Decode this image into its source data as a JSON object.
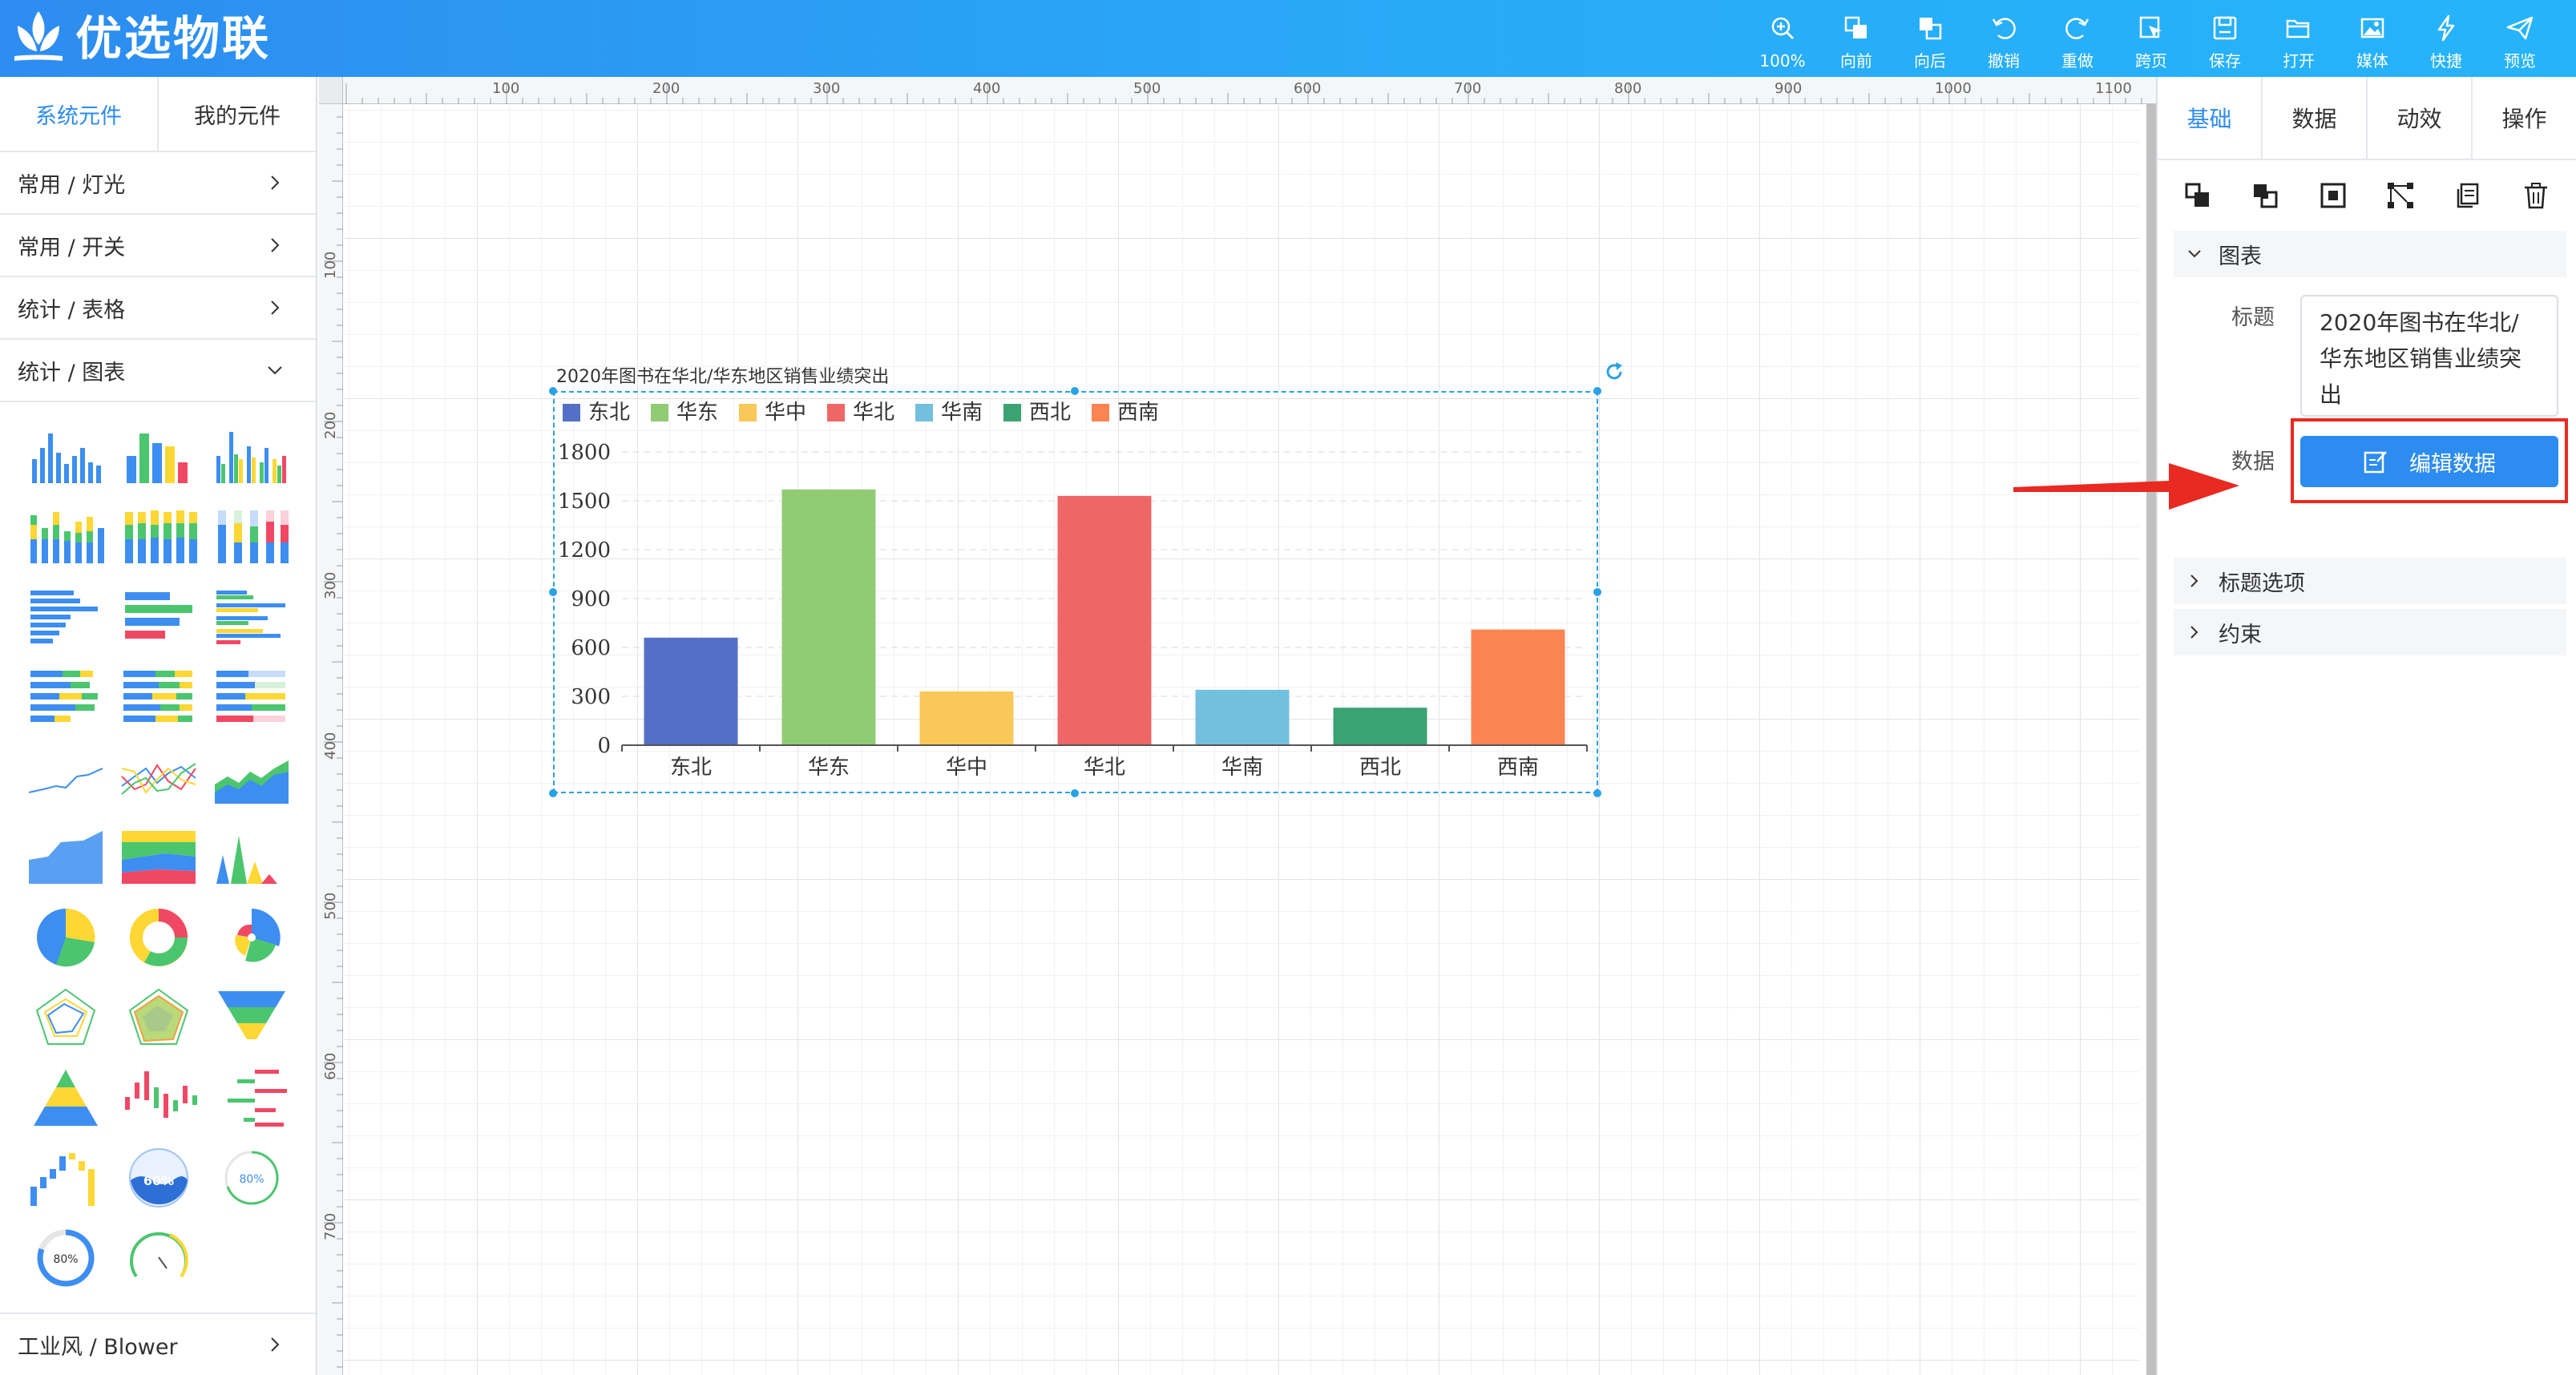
{
  "app": {
    "name": "优选物联"
  },
  "toolbar": [
    {
      "label": "100%",
      "icon": "zoom-in-icon"
    },
    {
      "label": "向前",
      "icon": "bring-forward-icon"
    },
    {
      "label": "向后",
      "icon": "send-backward-icon"
    },
    {
      "label": "撤销",
      "icon": "undo-icon"
    },
    {
      "label": "重做",
      "icon": "redo-icon"
    },
    {
      "label": "跨页",
      "icon": "cross-page-icon"
    },
    {
      "label": "保存",
      "icon": "save-icon"
    },
    {
      "label": "打开",
      "icon": "folder-open-icon"
    },
    {
      "label": "媒体",
      "icon": "media-icon"
    },
    {
      "label": "快捷",
      "icon": "lightning-icon"
    },
    {
      "label": "预览",
      "icon": "paper-plane-icon"
    }
  ],
  "left_panel": {
    "tabs": [
      {
        "label": "系统元件",
        "active": true
      },
      {
        "label": "我的元件",
        "active": false
      }
    ],
    "categories": [
      {
        "label": "常用 / 灯光",
        "expanded": false
      },
      {
        "label": "常用 / 开关",
        "expanded": false
      },
      {
        "label": "统计 / 表格",
        "expanded": false
      },
      {
        "label": "统计 / 图表",
        "expanded": true
      }
    ],
    "thumbnails": [
      {
        "kind": "bar-chart-icon"
      },
      {
        "kind": "multicolor-bar-chart-icon"
      },
      {
        "kind": "grouped-bar-chart-icon"
      },
      {
        "kind": "stacked-bar-chart-icon"
      },
      {
        "kind": "stacked-bar-chart-icon"
      },
      {
        "kind": "percent-stacked-bar-chart-icon"
      },
      {
        "kind": "horizontal-bar-chart-icon"
      },
      {
        "kind": "multicolor-horizontal-bar-chart-icon"
      },
      {
        "kind": "grouped-horizontal-bar-chart-icon"
      },
      {
        "kind": "stacked-horizontal-bar-chart-icon"
      },
      {
        "kind": "stacked-horizontal-bar-chart-icon"
      },
      {
        "kind": "percent-stacked-horizontal-bar-chart-icon"
      },
      {
        "kind": "line-chart-icon"
      },
      {
        "kind": "multi-line-chart-icon"
      },
      {
        "kind": "area-line-chart-icon"
      },
      {
        "kind": "area-chart-icon"
      },
      {
        "kind": "stacked-area-chart-icon"
      },
      {
        "kind": "spike-chart-icon"
      },
      {
        "kind": "pie-chart-icon"
      },
      {
        "kind": "donut-chart-icon"
      },
      {
        "kind": "rose-chart-icon"
      },
      {
        "kind": "radar-chart-icon"
      },
      {
        "kind": "filled-radar-chart-icon"
      },
      {
        "kind": "funnel-chart-icon"
      },
      {
        "kind": "pyramid-chart-icon"
      },
      {
        "kind": "candlestick-chart-icon"
      },
      {
        "kind": "diverging-bar-chart-icon"
      },
      {
        "kind": "waterfall-chart-icon"
      },
      {
        "kind": "liquid-fill-gauge-icon",
        "value": "60%"
      },
      {
        "kind": "ring-progress-icon",
        "value": "80%"
      },
      {
        "kind": "circle-progress-icon",
        "value": "80%"
      },
      {
        "kind": "dial-gauge-icon"
      }
    ],
    "bottom_category": {
      "label": "工业风 / Blower",
      "expanded": false
    }
  },
  "rulers": {
    "top_labels": [
      "100",
      "200",
      "300",
      "400",
      "500",
      "600",
      "700",
      "800",
      "900",
      "1000",
      "1100"
    ],
    "left_labels": [
      "100",
      "200",
      "300",
      "400",
      "500",
      "600",
      "700"
    ]
  },
  "chart_data": {
    "type": "bar",
    "title": "2020年图书在华北/华东地区销售业绩突出",
    "categories": [
      "东北",
      "华东",
      "华中",
      "华北",
      "华南",
      "西北",
      "西南"
    ],
    "values": [
      660,
      1570,
      330,
      1530,
      340,
      230,
      710
    ],
    "colors": [
      "#5470c6",
      "#91cc75",
      "#fac858",
      "#ee6666",
      "#73c0de",
      "#3ba272",
      "#fc8452"
    ],
    "legend": [
      "东北",
      "华东",
      "华中",
      "华北",
      "华南",
      "西北",
      "西南"
    ],
    "legend_position": "top-left",
    "ylim": [
      0,
      1800
    ],
    "yticks": [
      "0",
      "300",
      "600",
      "900",
      "1200",
      "1500",
      "1800"
    ],
    "grid": true
  },
  "right_panel": {
    "tabs": [
      {
        "label": "基础",
        "active": true
      },
      {
        "label": "数据",
        "active": false
      },
      {
        "label": "动效",
        "active": false
      },
      {
        "label": "操作",
        "active": false
      }
    ],
    "tools": [
      "bring-forward-icon",
      "send-backward-icon",
      "frame-select-icon",
      "align-nodes-icon",
      "copy-icon",
      "trash-icon"
    ],
    "section_chart": "图表",
    "title_label": "标题",
    "title_value": "2020年图书在华北/华东地区销售业绩突出",
    "data_label": "数据",
    "edit_button": "编辑数据",
    "section_title_options": "标题选项",
    "section_constraints": "约束"
  }
}
